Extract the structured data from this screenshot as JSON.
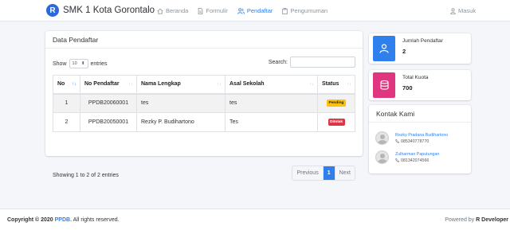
{
  "navbar": {
    "logo_letter": "R",
    "brand": "SMK 1 Kota Gorontalo",
    "items": [
      {
        "label": "Beranda",
        "icon": "home-icon"
      },
      {
        "label": "Formulir",
        "icon": "file-icon"
      },
      {
        "label": "Pendaftar",
        "icon": "users-icon",
        "active": true
      },
      {
        "label": "Pengumuman",
        "icon": "clipboard-icon"
      }
    ],
    "login": "Masuk"
  },
  "main": {
    "title": "Data Pendaftar",
    "show_label": "Show",
    "entries_value": "10",
    "entries_label": "entries",
    "search_label": "Search:",
    "columns": [
      "No",
      "No Pendaftar",
      "Nama Lengkap",
      "Asal Sekolah",
      "Status"
    ],
    "rows": [
      {
        "no": "1",
        "no_pendaftar": "PPDB20060001",
        "nama": "tes",
        "asal": "tes",
        "status": "Pending"
      },
      {
        "no": "2",
        "no_pendaftar": "PPDB20050001",
        "nama": "Rezky P. Budihartono",
        "asal": "Tes",
        "status": "Ditolak"
      }
    ],
    "info": "Showing 1 to 2 of 2 entries",
    "pagination": {
      "previous": "Previous",
      "current": "1",
      "next": "Next"
    }
  },
  "stats": [
    {
      "label": "Jumlah Pendaftar",
      "value": "2",
      "icon": "user-icon",
      "color": "#2f80ed"
    },
    {
      "label": "Total Kuota",
      "value": "700",
      "icon": "database-icon",
      "color": "#e0357f"
    }
  ],
  "contacts": {
    "title": "Kontak Kami",
    "items": [
      {
        "name": "Rezky Pradana Budihartono",
        "phone": "085340778770"
      },
      {
        "name": "Zulharman Paputungan",
        "phone": "081342074566"
      }
    ]
  },
  "footer": {
    "copyright_prefix": "Copyright © 2020",
    "brand": "PPDB.",
    "copyright_suffix": "All rights reserved.",
    "powered_prefix": "Powered by",
    "powered_by": "R Developer"
  }
}
